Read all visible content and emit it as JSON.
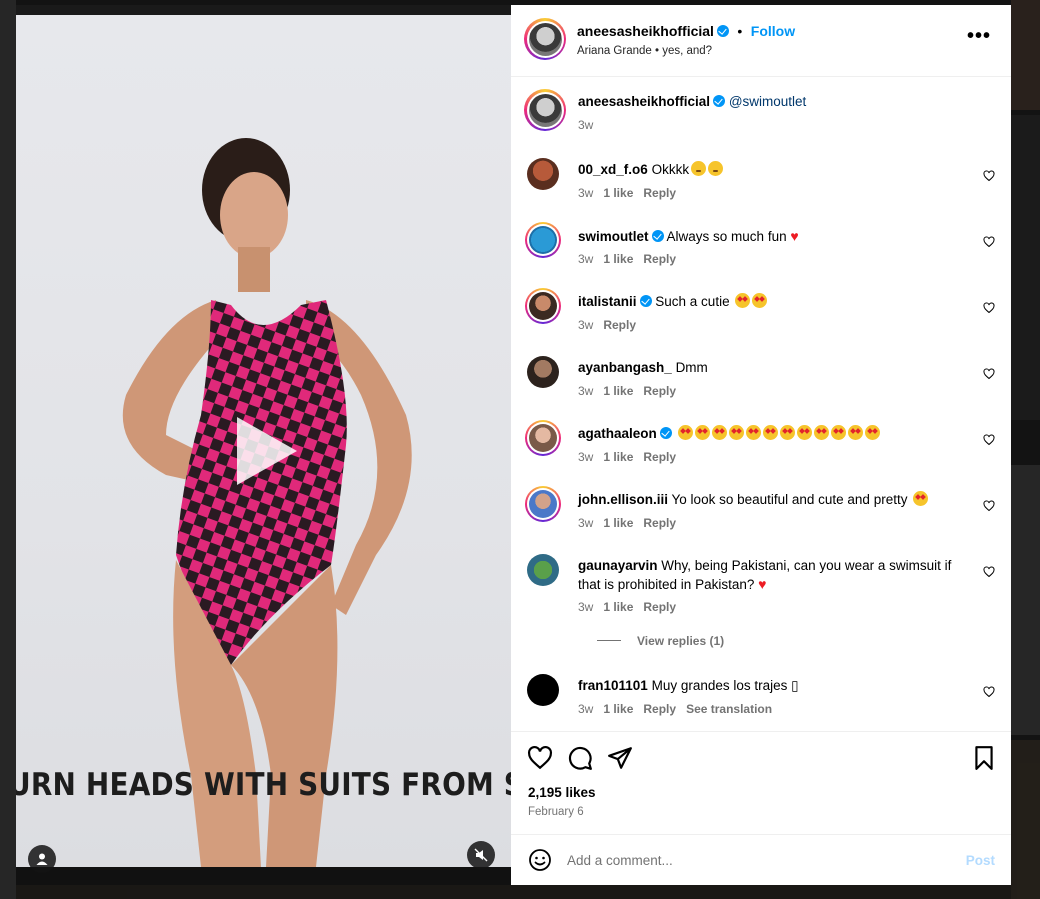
{
  "post": {
    "username": "aneesasheikhofficial",
    "follow_label": "Follow",
    "separator": "•",
    "audio": "Ariana Grande • yes, and?",
    "more_label": "•••",
    "caption_mention": "@swimoutlet",
    "caption_time": "3w",
    "video_overlay_text": "URN HEADS WITH SUITS FROM SPORT",
    "likes": "2,195 likes",
    "date": "February 6"
  },
  "comments": [
    {
      "user": "00_xd_f.o6",
      "text": "Okkkk",
      "emoji": [
        "flush",
        "flush"
      ],
      "time": "3w",
      "likes": "1 like",
      "reply": "Reply",
      "verified": false
    },
    {
      "user": "swimoutlet",
      "text": "Always so much fun",
      "heart": "♥",
      "time": "3w",
      "likes": "1 like",
      "reply": "Reply",
      "verified": true
    },
    {
      "user": "italistanii",
      "text": "Such a cutie",
      "emoji": [
        "star",
        "star"
      ],
      "time": "3w",
      "likes": "",
      "reply": "Reply",
      "verified": true
    },
    {
      "user": "ayanbangash_",
      "text": "Dmm",
      "time": "3w",
      "likes": "1 like",
      "reply": "Reply",
      "verified": false
    },
    {
      "user": "agathaaleon",
      "text": "",
      "emoji": [
        "star",
        "star",
        "star",
        "star",
        "star",
        "star",
        "star",
        "star",
        "star",
        "star",
        "star",
        "star"
      ],
      "time": "3w",
      "likes": "1 like",
      "reply": "Reply",
      "verified": true
    },
    {
      "user": "john.ellison.iii",
      "text": "Yo look so beautiful and cute and pretty",
      "emoji": [
        "star"
      ],
      "time": "3w",
      "likes": "1 like",
      "reply": "Reply",
      "verified": false
    },
    {
      "user": "gaunayarvin",
      "text": "Why, being Pakistani, can you wear a swimsuit if that is prohibited in Pakistan?",
      "heart": "♥",
      "time": "3w",
      "likes": "1 like",
      "reply": "Reply",
      "verified": false,
      "view_replies": "View replies (1)"
    },
    {
      "user": "fran101101",
      "text": "Muy grandes los trajes ▯",
      "time": "3w",
      "likes": "1 like",
      "reply": "Reply",
      "translate": "See translation",
      "verified": false
    }
  ],
  "add_comment": {
    "placeholder": "Add a comment...",
    "post_label": "Post"
  },
  "colors": {
    "accent": "#0095f6",
    "muted": "#737373",
    "heart": "#ed1c24"
  }
}
